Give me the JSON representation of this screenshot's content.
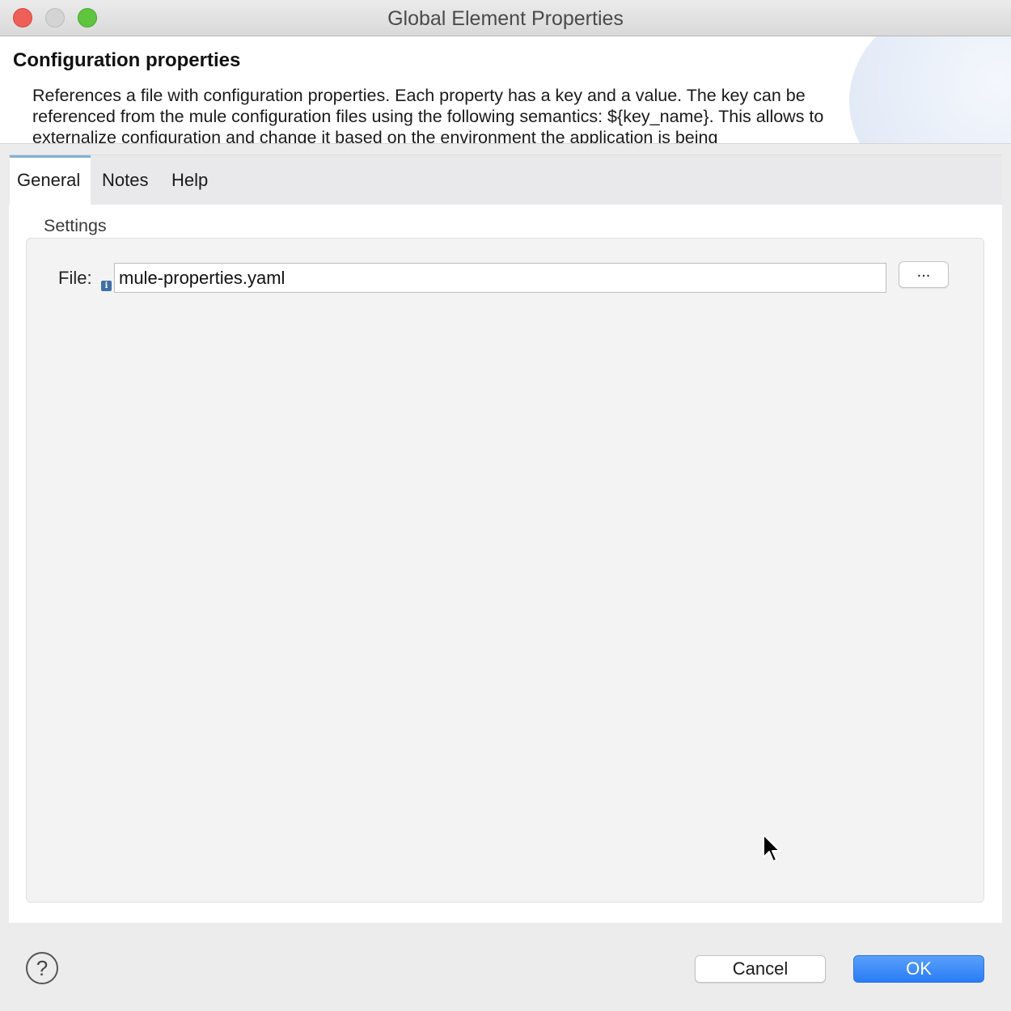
{
  "window": {
    "title": "Global Element Properties"
  },
  "header": {
    "title": "Configuration properties",
    "description": "References a file with configuration properties. Each property has a key and a value. The key can be referenced from the mule configuration files using the following semantics: ${key_name}. This allows to externalize configuration and change it based on the environment the application is being"
  },
  "tabs": [
    {
      "label": "General",
      "active": true
    },
    {
      "label": "Notes",
      "active": false
    },
    {
      "label": "Help",
      "active": false
    }
  ],
  "settings": {
    "group_label": "Settings",
    "file_label": "File:",
    "file_value": "mule-properties.yaml",
    "browse_label": "...",
    "info_icon": "i"
  },
  "footer": {
    "help_icon": "?",
    "cancel_label": "Cancel",
    "ok_label": "OK"
  },
  "colors": {
    "ok_button": "#2a7cf6",
    "close": "#ee5f58",
    "maximize": "#5fc53f",
    "active_tab_indicator": "#7eb0d9"
  }
}
